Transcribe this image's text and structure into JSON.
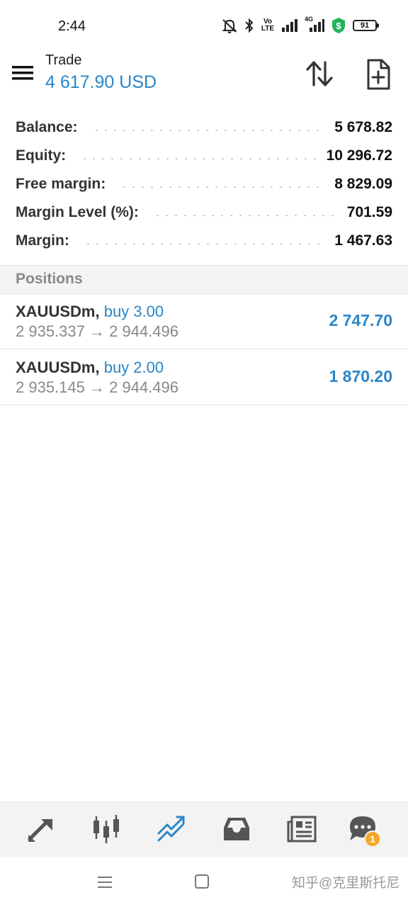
{
  "status_bar": {
    "time": "2:44",
    "volte_label": "Vo LTE",
    "network_label": "4G",
    "battery": "91"
  },
  "header": {
    "title": "Trade",
    "balance_display": "4 617.90 USD"
  },
  "account": [
    {
      "label": "Balance:",
      "value": "5 678.82"
    },
    {
      "label": "Equity:",
      "value": "10 296.72"
    },
    {
      "label": "Free margin:",
      "value": "8 829.09"
    },
    {
      "label": "Margin Level (%):",
      "value": "701.59"
    },
    {
      "label": "Margin:",
      "value": "1 467.63"
    }
  ],
  "positions": {
    "section_label": "Positions",
    "items": [
      {
        "symbol": "XAUUSDm,",
        "side": "buy 3.00",
        "open_price": "2 935.337",
        "arrow": "→",
        "current_price": "2 944.496",
        "profit": "2 747.70"
      },
      {
        "symbol": "XAUUSDm,",
        "side": "buy 2.00",
        "open_price": "2 935.145",
        "arrow": "→",
        "current_price": "2 944.496",
        "profit": "1 870.20"
      }
    ]
  },
  "bottom_nav": {
    "items": [
      "quotes-icon",
      "chart-icon",
      "trade-icon",
      "history-icon",
      "news-icon",
      "chat-icon"
    ],
    "active": "trade-icon",
    "chat_badge": "1",
    "active_color": "#2a86c8",
    "inactive_color": "#555555"
  },
  "watermark": "知乎@克里斯托尼",
  "colors": {
    "accent": "#2a86c8",
    "badge": "#f5a623"
  }
}
